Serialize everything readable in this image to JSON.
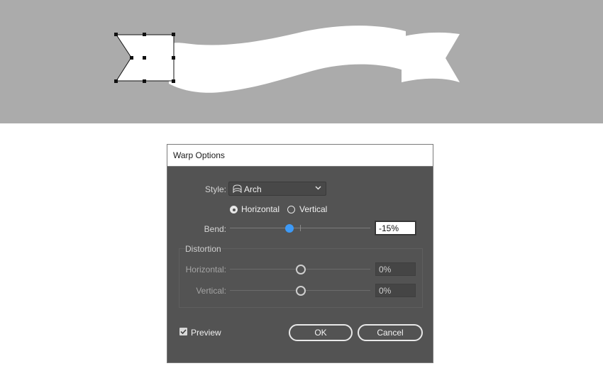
{
  "dialog": {
    "title": "Warp Options",
    "style_label": "Style:",
    "style_value": "Arch",
    "style_icon": "arch-icon",
    "orientation": {
      "horizontal_label": "Horizontal",
      "vertical_label": "Vertical",
      "selected": "Horizontal"
    },
    "bend": {
      "label": "Bend:",
      "value": "-15%",
      "level": -15
    },
    "distortion": {
      "title": "Distortion",
      "horizontal_label": "Horizontal:",
      "horizontal_value": "0%",
      "vertical_label": "Vertical:",
      "vertical_value": "0%"
    },
    "preview": {
      "label": "Preview",
      "checked": true
    },
    "ok_label": "OK",
    "cancel_label": "Cancel"
  },
  "colors": {
    "canvas_bg": "#ababab",
    "dialog_bg": "#535353",
    "accent": "#3d9af7",
    "ribbon": "#ffffff"
  }
}
